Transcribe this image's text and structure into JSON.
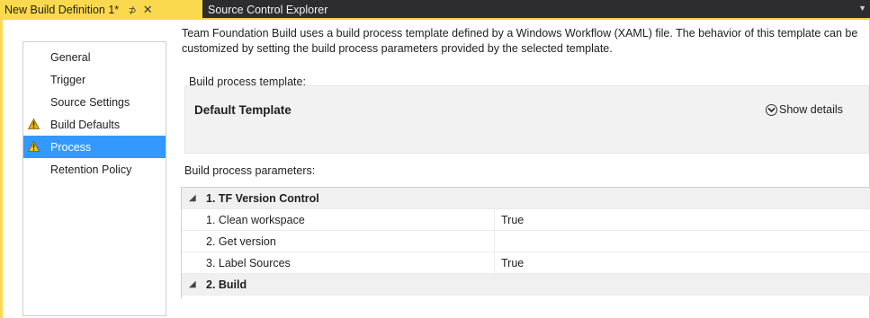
{
  "tabs": {
    "active": {
      "title": "New Build Definition 1*",
      "pin_glyph": "⊅",
      "close_glyph": "✕"
    },
    "inactive": {
      "title": "Source Control Explorer"
    }
  },
  "nav": {
    "items": [
      {
        "label": "General",
        "warning": false,
        "selected": false
      },
      {
        "label": "Trigger",
        "warning": false,
        "selected": false
      },
      {
        "label": "Source Settings",
        "warning": false,
        "selected": false
      },
      {
        "label": "Build Defaults",
        "warning": true,
        "selected": false
      },
      {
        "label": "Process",
        "warning": true,
        "selected": true
      },
      {
        "label": "Retention Policy",
        "warning": false,
        "selected": false
      }
    ]
  },
  "content": {
    "intro": "Team Foundation Build uses a build process template defined by a Windows Workflow (XAML) file. The behavior of this template can be customized by setting the build process parameters provided by the selected template.",
    "template_group_label": "Build process template:",
    "template_name": "Default Template",
    "show_details": "Show details",
    "params_label": "Build process parameters:"
  },
  "grid": {
    "rows": [
      {
        "kind": "cat",
        "label": "1. TF Version Control"
      },
      {
        "kind": "prop",
        "name": "1. Clean workspace",
        "value": "True"
      },
      {
        "kind": "prop",
        "name": "2. Get version",
        "value": ""
      },
      {
        "kind": "prop",
        "name": "3. Label Sources",
        "value": "True"
      },
      {
        "kind": "cat",
        "label": "2. Build"
      }
    ]
  },
  "colors": {
    "accent": "#fbd94e",
    "selection": "#3399ff",
    "warning": "#e8b10b"
  }
}
